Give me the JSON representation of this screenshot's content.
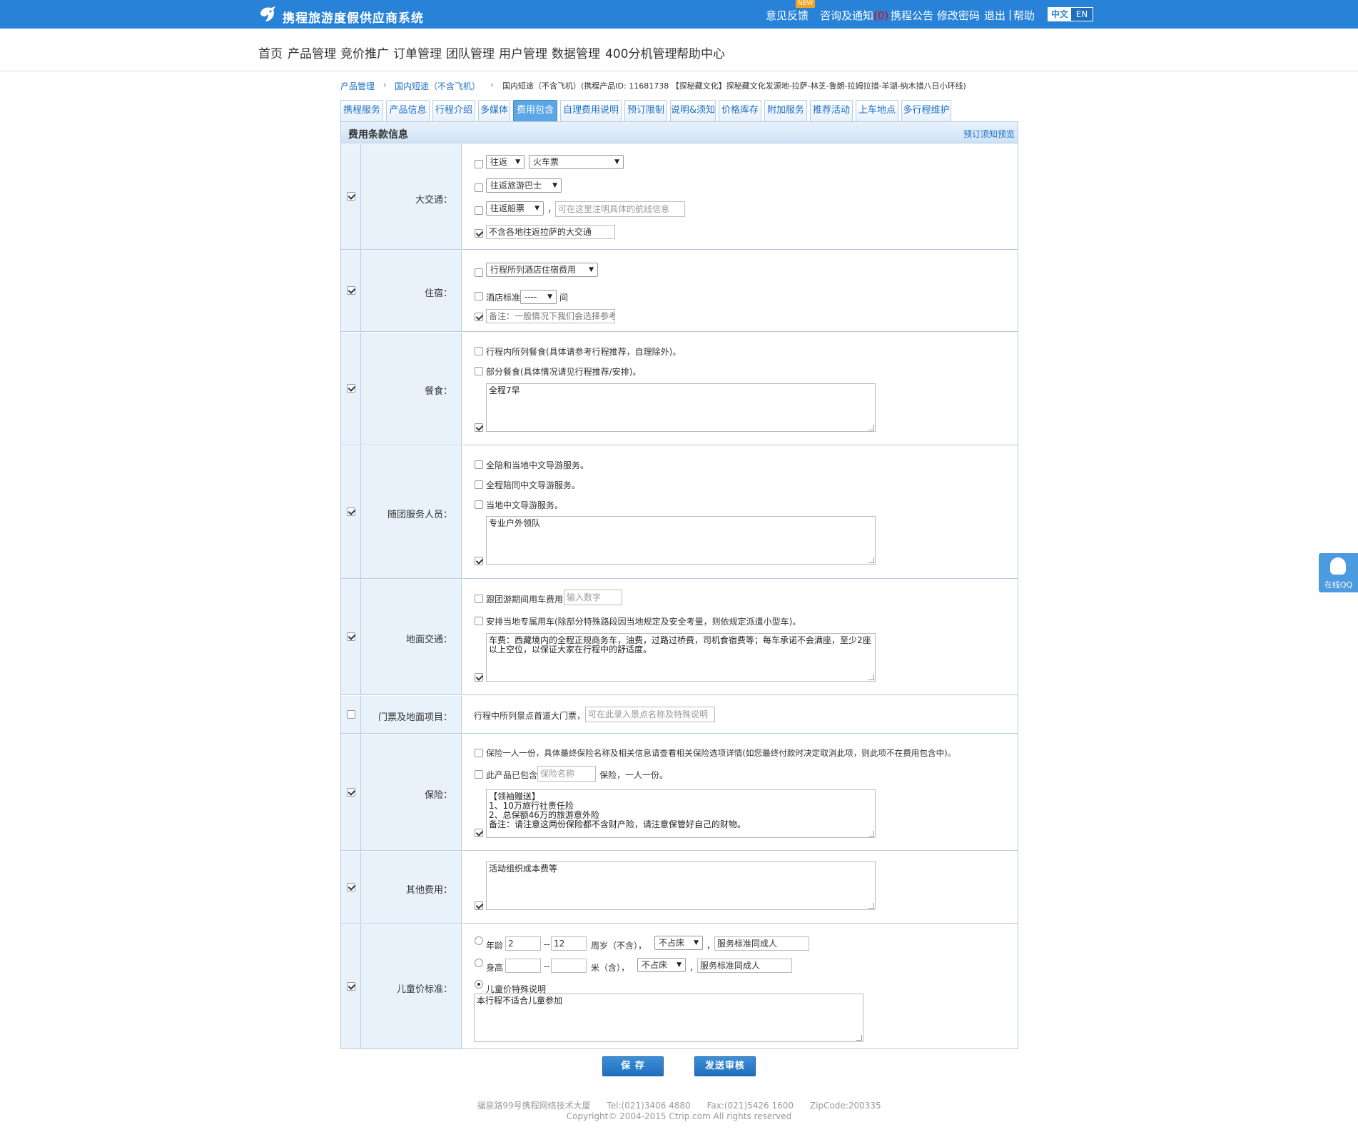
{
  "app": {
    "title": "携程旅游度假供应商系统",
    "new_badge": "NEW"
  },
  "toplinks": {
    "feedback": "意见反馈",
    "consult": "咨询及通知",
    "consult_count": "(0)",
    "notice": "携程公告",
    "password": "修改密码",
    "logout": "退出",
    "sep": "|",
    "help": "帮助",
    "lang_zh": "中文",
    "lang_en": "EN"
  },
  "nav": [
    "首页",
    "产品管理",
    "竞价推广",
    "订单管理",
    "团队管理",
    "用户管理",
    "数据管理",
    "400分机管理",
    "帮助中心"
  ],
  "breadcrumb": {
    "c1": "产品管理",
    "c2": "国内短途（不含飞机）",
    "c3": "国内短途（不含飞机）(携程产品ID: 11681738 【探秘藏文化】探秘藏文化发源地-拉萨-林芝-鲁朗-拉姆拉措-羊湖-纳木措八日小环线)"
  },
  "tabs": [
    "携程服务",
    "产品信息",
    "行程介绍",
    "多媒体",
    "费用包含",
    "自理费用说明",
    "预订限制",
    "说明&须知",
    "价格库存",
    "附加服务",
    "推荐活动",
    "上车地点",
    "多行程维护"
  ],
  "panel": {
    "title": "费用条款信息",
    "preview": "预订须知预览"
  },
  "traffic": {
    "label": "大交通：",
    "sel1": "往返",
    "sel2": "火车票",
    "sel3": "往返旅游巴士",
    "sel4": "往返船票",
    "comma": "，",
    "ship_placeholder": "可在这里注明具体的航线信息",
    "note": "不含各地往返拉萨的大交通"
  },
  "hotel": {
    "label": "住宿：",
    "sel": "行程所列酒店住宿费用",
    "std": "酒店标准",
    "std_sel": "----",
    "room": "间",
    "note": "备注：一般情况下我们会选择参考"
  },
  "meal": {
    "label": "餐食：",
    "opt1": "行程内所列餐食(具体请参考行程推荐，自理除外)。",
    "opt2": "部分餐食(具体情况请见行程推荐/安排)。",
    "note": "全程7早"
  },
  "guide": {
    "label": "随团服务人员：",
    "opt1": "全陪和当地中文导游服务。",
    "opt2": "全程陪同中文导游服务。",
    "opt3": "当地中文导游服务。",
    "note": "专业户外领队"
  },
  "ground": {
    "label": "地面交通：",
    "opt1": "跟团游期间用车费用",
    "opt1_ph": "输入数字",
    "opt2": "安排当地专属用车(除部分特殊路段因当地规定及安全考量，则依规定派遣小型车)。",
    "note": "车费：西藏境内的全程正规商务车，油费，过路过桥费，司机食宿费等；每车承诺不会满座，至少2座以上空位，以保证大家在行程中的舒适度。"
  },
  "ticket": {
    "label": "门票及地面项目：",
    "text": "行程中所列景点首道大门票，",
    "ph": "可在此录入景点名称及特殊说明"
  },
  "insurance": {
    "label": "保险：",
    "opt1": "保险一人一份，具体最终保险名称及相关信息请查看相关保险选项详情(如您最终付款时决定取消此项，则此项不在费用包含中)。",
    "opt2a": "此产品已包含",
    "opt2_ph": "保险名称",
    "opt2b": "保险，一人一份。",
    "note": "【领袖赠送】\n1、10万旅行社责任险\n2、总保额46万的旅游意外险\n备注：请注意这两份保险都不含财产险，请注意保管好自己的财物。"
  },
  "other": {
    "label": "其他费用：",
    "note": "活动组织成本费等"
  },
  "child": {
    "label": "儿童价标准：",
    "age": "年龄",
    "age_from": "2",
    "dash": "--",
    "age_to": "12",
    "age_unit": "周岁（不含），",
    "bed1": "不占床",
    "comma": "，",
    "service1": "服务标准同成人",
    "height": "身高",
    "h_unit": "米（含），",
    "bed2": "不占床",
    "service2": "服务标准同成人",
    "special": "儿童价特殊说明",
    "special_note": "本行程不适合儿童参加"
  },
  "buttons": {
    "save": "保 存",
    "submit": "发送审核"
  },
  "footer": {
    "line1": "福泉路99号携程网络技术大厦      Tel:(021)3406 4880      Fax:(021)5426 1600      ZipCode:200335",
    "line2": "Copyright© 2004-2015 Ctrip.com All rights reserved"
  },
  "qq": {
    "label": "在线QQ"
  }
}
